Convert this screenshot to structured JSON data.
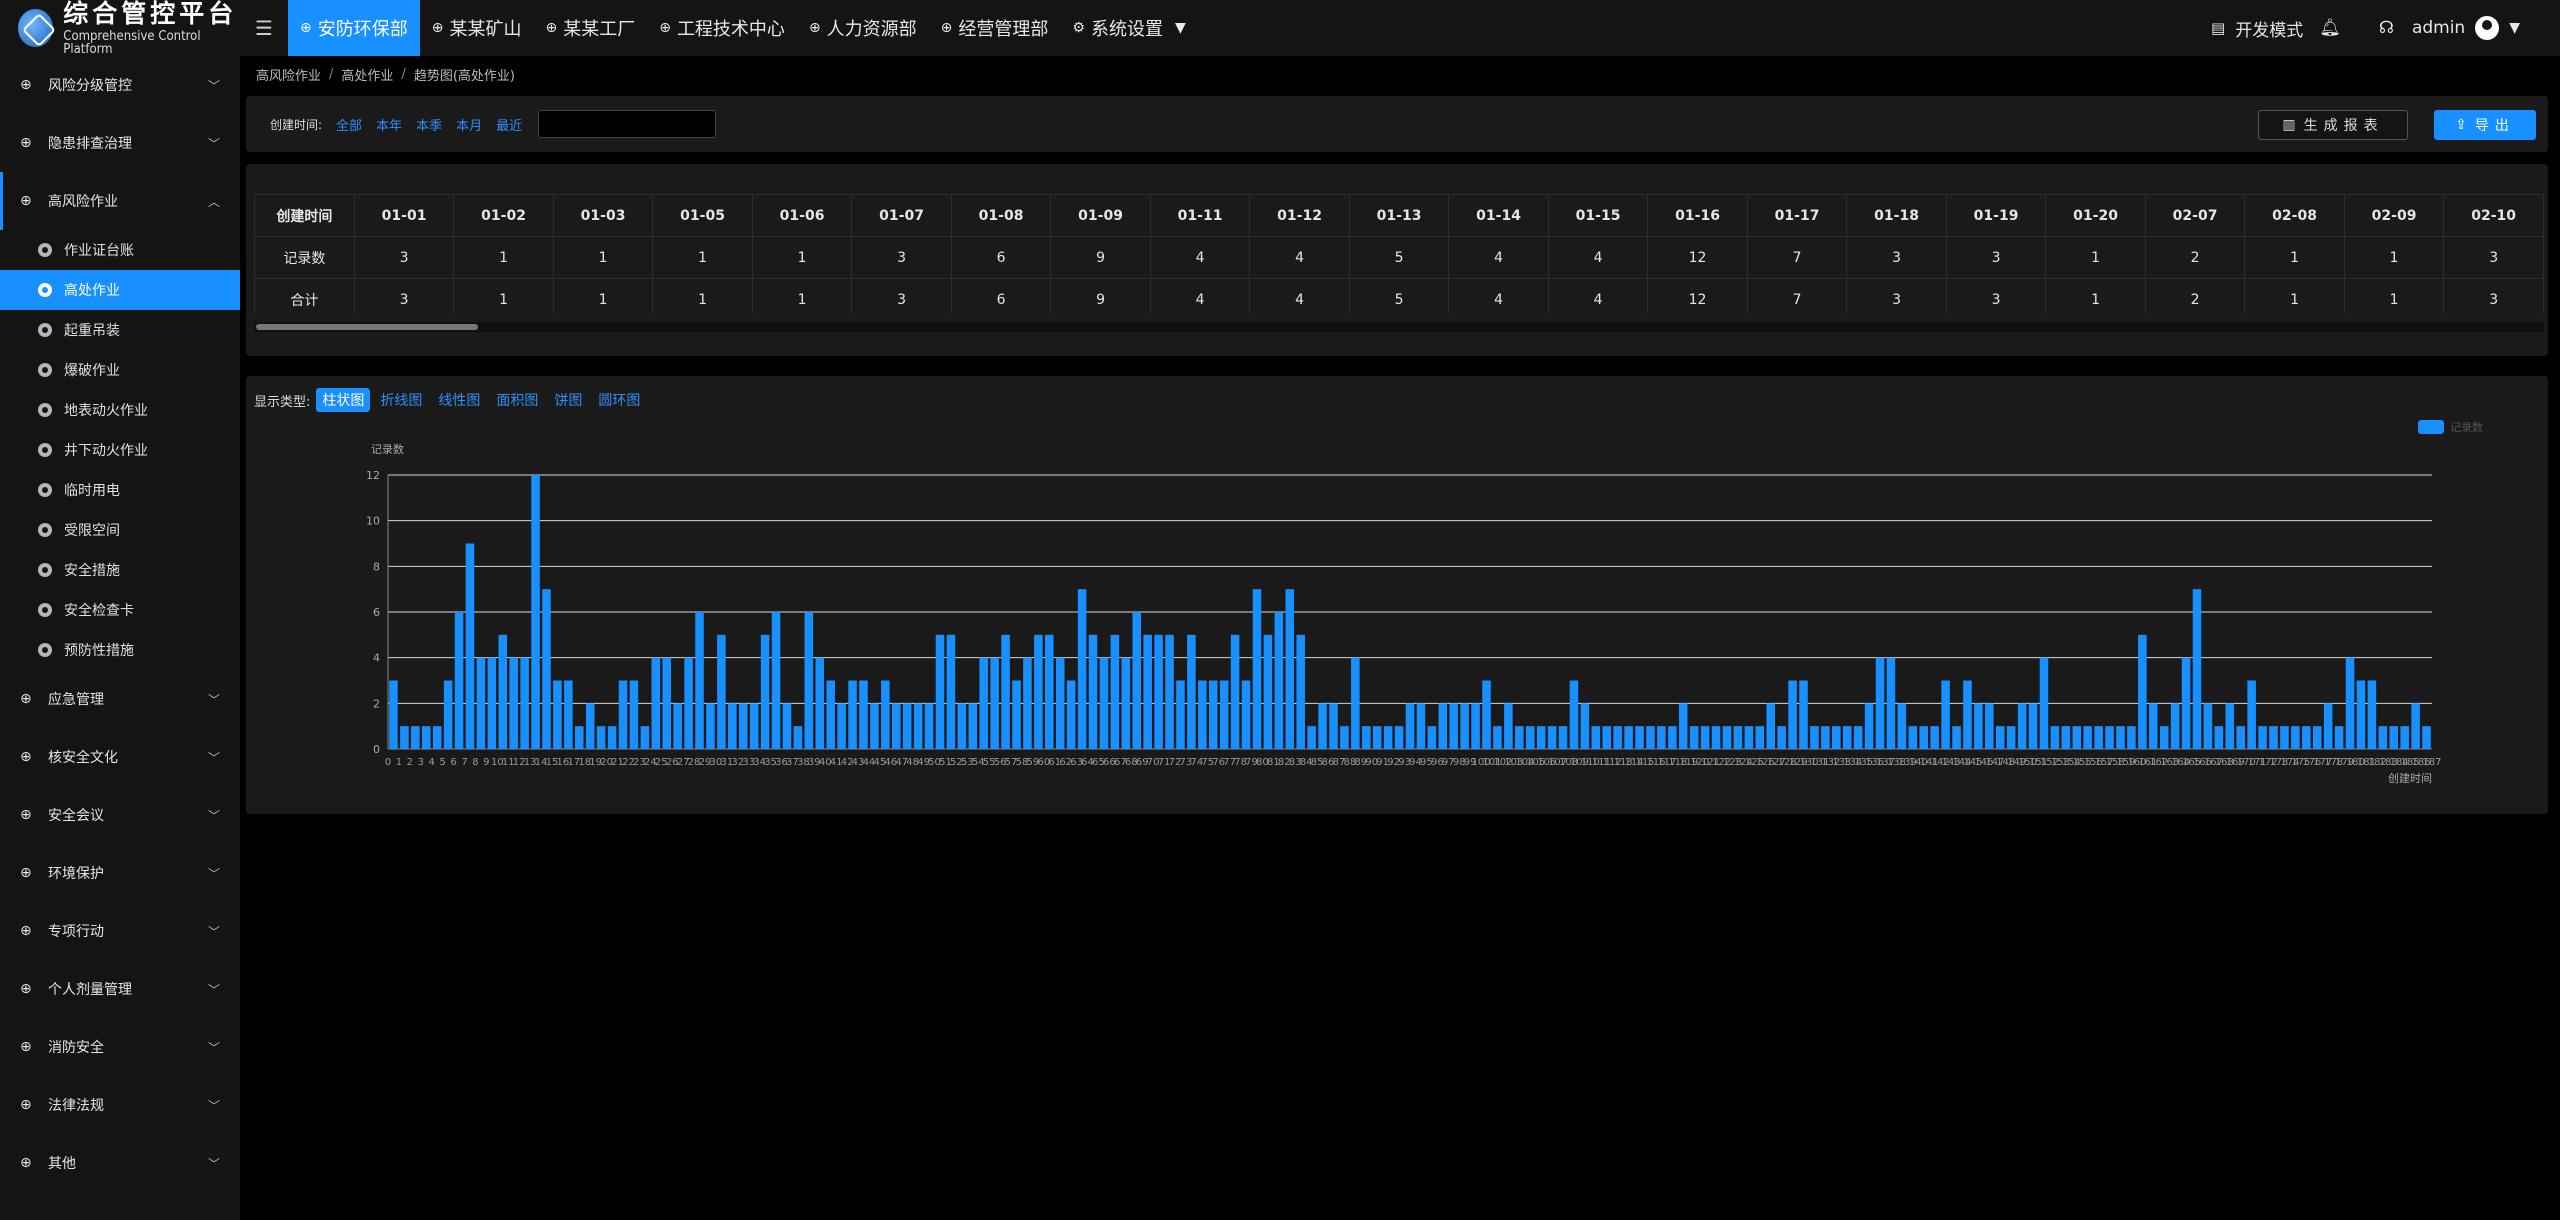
{
  "app": {
    "title_cn": "综合管控平台",
    "title_en": "Comprehensive Control Platform"
  },
  "nav": [
    {
      "label": "安防环保部",
      "icon": "grid-icon",
      "active": true
    },
    {
      "label": "某某矿山",
      "icon": "grid-icon"
    },
    {
      "label": "某某工厂",
      "icon": "grid-icon"
    },
    {
      "label": "工程技术中心",
      "icon": "grid-icon"
    },
    {
      "label": "人力资源部",
      "icon": "grid-icon"
    },
    {
      "label": "经营管理部",
      "icon": "grid-icon"
    },
    {
      "label": "系统设置",
      "icon": "gear-icon",
      "dropdown": true
    }
  ],
  "topright": {
    "dev_mode": "开发模式",
    "user": "admin"
  },
  "sidebar": {
    "top_items": [
      {
        "label": "风险分级管控"
      },
      {
        "label": "隐患排查治理"
      }
    ],
    "open_item": {
      "label": "高风险作业"
    },
    "sub_items": [
      {
        "label": "作业证台账"
      },
      {
        "label": "高处作业",
        "active": true
      },
      {
        "label": "起重吊装"
      },
      {
        "label": "爆破作业"
      },
      {
        "label": "地表动火作业"
      },
      {
        "label": "井下动火作业"
      },
      {
        "label": "临时用电"
      },
      {
        "label": "受限空间"
      },
      {
        "label": "安全措施"
      },
      {
        "label": "安全检查卡"
      },
      {
        "label": "预防性措施"
      }
    ],
    "bottom_items": [
      {
        "label": "应急管理"
      },
      {
        "label": "核安全文化"
      },
      {
        "label": "安全会议"
      },
      {
        "label": "环境保护"
      },
      {
        "label": "专项行动"
      },
      {
        "label": "个人剂量管理"
      },
      {
        "label": "消防安全"
      },
      {
        "label": "法律法规"
      },
      {
        "label": "其他"
      }
    ]
  },
  "breadcrumb": [
    "高风险作业",
    "高处作业",
    "趋势图(高处作业)"
  ],
  "filter": {
    "label": "创建时间:",
    "links": [
      "全部",
      "本年",
      "本季",
      "本月",
      "最近"
    ],
    "date_value": ""
  },
  "buttons": {
    "report": "生成报表",
    "export": "导出"
  },
  "table": {
    "row_header": "创建时间",
    "columns": [
      "01-01",
      "01-02",
      "01-03",
      "01-05",
      "01-06",
      "01-07",
      "01-08",
      "01-09",
      "01-11",
      "01-12",
      "01-13",
      "01-14",
      "01-15",
      "01-16",
      "01-17",
      "01-18",
      "01-19",
      "01-20",
      "02-07",
      "02-08",
      "02-09",
      "02-10"
    ],
    "rows": [
      {
        "label": "记录数",
        "values": [
          "3",
          "1",
          "1",
          "1",
          "1",
          "3",
          "6",
          "9",
          "4",
          "4",
          "5",
          "4",
          "4",
          "12",
          "7",
          "3",
          "3",
          "1",
          "2",
          "1",
          "1",
          "3"
        ]
      },
      {
        "label": "合计",
        "values": [
          "3",
          "1",
          "1",
          "1",
          "1",
          "3",
          "6",
          "9",
          "4",
          "4",
          "5",
          "4",
          "4",
          "12",
          "7",
          "3",
          "3",
          "1",
          "2",
          "1",
          "1",
          "3"
        ]
      }
    ]
  },
  "chart_types": {
    "label": "显示类型:",
    "options": [
      "柱状图",
      "折线图",
      "线性图",
      "面积图",
      "饼图",
      "圆环图"
    ],
    "active": "柱状图"
  },
  "chart_data": {
    "type": "bar",
    "ylabel": "记录数",
    "xlabel": "创建时间",
    "ylim": [
      0,
      12
    ],
    "yticks": [
      0,
      2,
      4,
      6,
      8,
      10,
      12
    ],
    "legend": "top-right",
    "grid": true,
    "series": [
      {
        "name": "记录数",
        "color": "#1890ff",
        "values": [
          3,
          1,
          1,
          1,
          1,
          3,
          6,
          9,
          4,
          4,
          5,
          4,
          4,
          12,
          7,
          3,
          3,
          1,
          2,
          1,
          1,
          3,
          3,
          1,
          4,
          4,
          2,
          4,
          6,
          2,
          5,
          2,
          2,
          2,
          5,
          6,
          2,
          1,
          6,
          4,
          3,
          2,
          3,
          3,
          2,
          3,
          2,
          2,
          2,
          2,
          5,
          5,
          2,
          2,
          4,
          4,
          5,
          3,
          4,
          5,
          5,
          4,
          3,
          7,
          5,
          4,
          5,
          4,
          6,
          5,
          5,
          5,
          3,
          5,
          3,
          3,
          3,
          5,
          3,
          7,
          5,
          6,
          7,
          5,
          1,
          2,
          2,
          1,
          4,
          1,
          1,
          1,
          1,
          2,
          2,
          1,
          2,
          2,
          2,
          2,
          3,
          1,
          2,
          1,
          1,
          1,
          1,
          1,
          3,
          2,
          1,
          1,
          1,
          1,
          1,
          1,
          1,
          1,
          2,
          1,
          1,
          1,
          1,
          1,
          1,
          1,
          2,
          1,
          3,
          3,
          1,
          1,
          1,
          1,
          1,
          2,
          4,
          4,
          2,
          1,
          1,
          1,
          3,
          1,
          3,
          2,
          2,
          1,
          1,
          2,
          2,
          4,
          1,
          1,
          1,
          1,
          1,
          1,
          1,
          1,
          5,
          2,
          1,
          2,
          4,
          7,
          2,
          1,
          2,
          1,
          3,
          1,
          1,
          1,
          1,
          1,
          1,
          2,
          1,
          4,
          3,
          3,
          1,
          1,
          1,
          2,
          1
        ]
      }
    ]
  }
}
